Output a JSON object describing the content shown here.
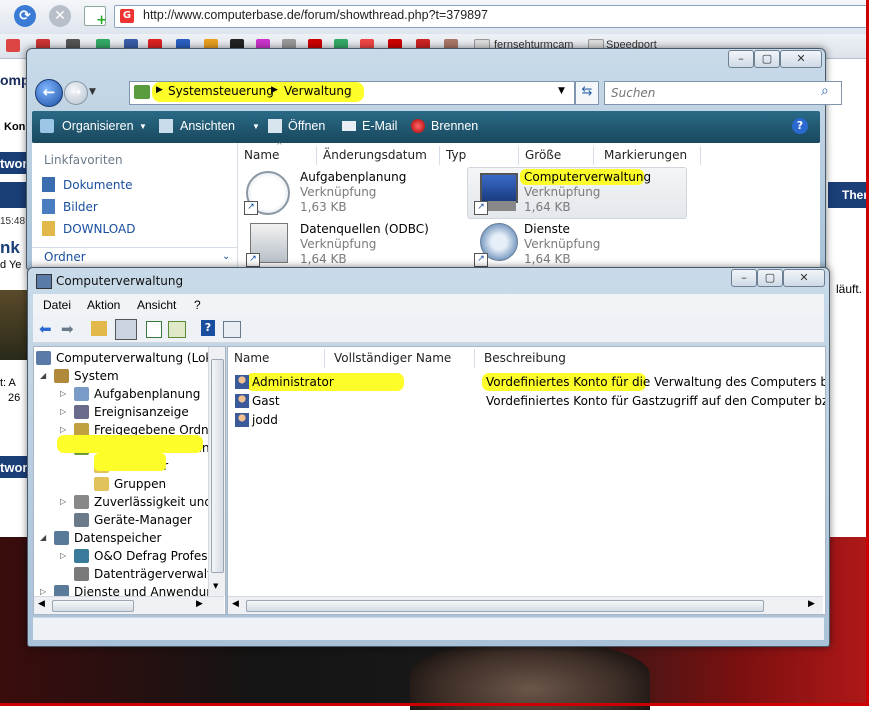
{
  "browser": {
    "url": "http://www.computerbase.de/forum/showthread.php?t=379897",
    "bookmarks": [
      "fernsehturmcam",
      "Speedport"
    ],
    "fragments": {
      "compute": "ompute",
      "kon": "Kon",
      "twor": "twor",
      "thera": "Thera",
      "time": "15:48",
      "lauft": "läuft.",
      "nk": "nk",
      "dye": "d Ye",
      "t": "t: A",
      "n26": "26",
      "twor2": "twor"
    }
  },
  "explorer": {
    "breadcrumb": [
      "Systemsteuerung",
      "Verwaltung"
    ],
    "search_placeholder": "Suchen",
    "toolbar": [
      "Organisieren",
      "Ansichten",
      "Öffnen",
      "E-Mail",
      "Brennen"
    ],
    "favorites_title": "Linkfavoriten",
    "favorites": [
      "Dokumente",
      "Bilder",
      "DOWNLOAD"
    ],
    "folders_label": "Ordner",
    "columns": [
      "Name",
      "Änderungsdatum",
      "Typ",
      "Größe",
      "Markierungen"
    ],
    "files": [
      {
        "name": "Aufgabenplanung",
        "type": "Verknüpfung",
        "size": "1,63 KB"
      },
      {
        "name": "Computerverwaltung",
        "type": "Verknüpfung",
        "size": "1,64 KB"
      },
      {
        "name": "Datenquellen (ODBC)",
        "type": "Verknüpfung",
        "size": "1,64 KB"
      },
      {
        "name": "Dienste",
        "type": "Verknüpfung",
        "size": "1,64 KB"
      }
    ]
  },
  "compmgmt": {
    "title": "Computerverwaltung",
    "menu": [
      "Datei",
      "Aktion",
      "Ansicht",
      "?"
    ],
    "tree": [
      {
        "label": "Computerverwaltung (Loka",
        "level": 0,
        "exp": ""
      },
      {
        "label": "System",
        "level": 1,
        "exp": "open"
      },
      {
        "label": "Aufgabenplanung",
        "level": 2,
        "exp": "closed"
      },
      {
        "label": "Ereignisanzeige",
        "level": 2,
        "exp": "closed"
      },
      {
        "label": "Freigegebene Ordne",
        "level": 2,
        "exp": "closed"
      },
      {
        "label": "Lokale Benutzer und",
        "level": 2,
        "exp": "open"
      },
      {
        "label": "Benutzer",
        "level": 3,
        "exp": ""
      },
      {
        "label": "Gruppen",
        "level": 3,
        "exp": ""
      },
      {
        "label": "Zuverlässigkeit und l",
        "level": 2,
        "exp": "closed"
      },
      {
        "label": "Geräte-Manager",
        "level": 2,
        "exp": ""
      },
      {
        "label": "Datenspeicher",
        "level": 1,
        "exp": "open"
      },
      {
        "label": "O&O Defrag Profess",
        "level": 2,
        "exp": "closed"
      },
      {
        "label": "Datenträgerverwaltu",
        "level": 2,
        "exp": ""
      },
      {
        "label": "Dienste und Anwendung",
        "level": 1,
        "exp": "closed"
      }
    ],
    "columns": [
      "Name",
      "Vollständiger Name",
      "Beschreibung"
    ],
    "users": [
      {
        "name": "Administrator",
        "fullname": "",
        "description": "Vordefiniertes Konto für die Verwaltung des Computers bzw. der"
      },
      {
        "name": "Gast",
        "fullname": "",
        "description": "Vordefiniertes Konto für Gastzugriff auf den Computer bzw. die"
      },
      {
        "name": "jodd",
        "fullname": "",
        "description": ""
      }
    ]
  },
  "colors": {
    "highlight": "#fdfd2a",
    "explorer_toolbar": "#1f5670",
    "aero_frame": "#b8cfe2"
  }
}
